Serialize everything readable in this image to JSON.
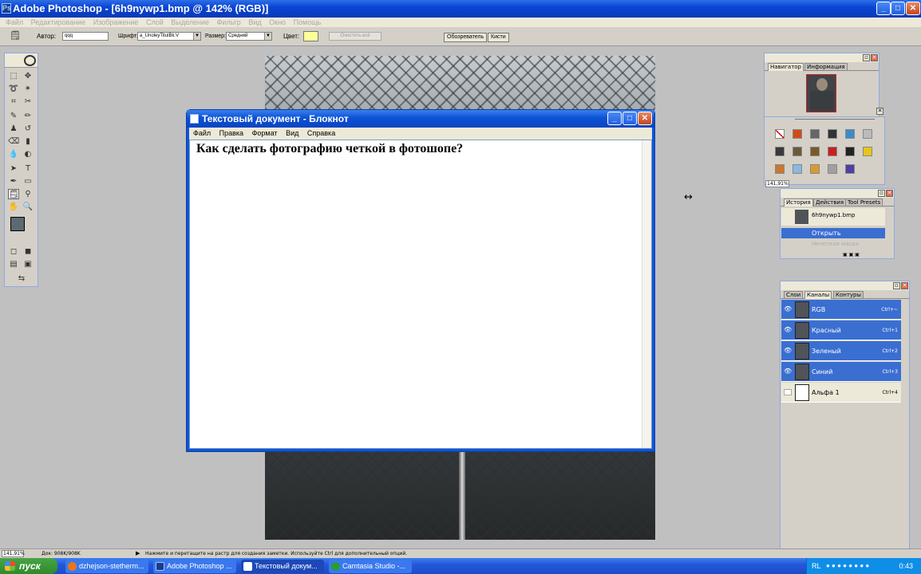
{
  "photoshop": {
    "title": "Adobe Photoshop - [6h9nywp1.bmp @ 142% (RGB)]",
    "menu": [
      "Файл",
      "Редактирование",
      "Изображение",
      "Слой",
      "Выделение",
      "Фильтр",
      "Вид",
      "Окно",
      "Помощь"
    ],
    "options": {
      "author_label": "Автор:",
      "author_value": "qqq",
      "font_label": "Шрифт:",
      "font_value": "a_UnoleyTitulBk:V",
      "size_label": "Размер:",
      "size_value": "Средний",
      "color_label": "Цвет:",
      "clear_button": "Очистить всё",
      "palette_tabs": [
        "Обозреватель",
        "Кисти"
      ]
    },
    "status": {
      "zoom": "141,91%",
      "doc": "Док: 908K/908K",
      "hint": "Нажмите и перетащите на растр для создания заметки. Используйте Ctrl для дополнительный опций."
    }
  },
  "navigator": {
    "tabs": [
      "Навигатор",
      "Информация"
    ],
    "zoom": "141,91%"
  },
  "history": {
    "tabs": [
      "История",
      "Действия",
      "Tool Presets"
    ],
    "snapshot": "6h9nywp1.bmp",
    "items": [
      "Открыть",
      "Нечеткая маска"
    ]
  },
  "channels": {
    "tabs": [
      "Слои",
      "Каналы",
      "Контуры"
    ],
    "rows": [
      {
        "name": "RGB",
        "shortcut": "Ctrl+~"
      },
      {
        "name": "Красный",
        "shortcut": "Ctrl+1"
      },
      {
        "name": "Зеленый",
        "shortcut": "Ctrl+2"
      },
      {
        "name": "Синий",
        "shortcut": "Ctrl+3"
      },
      {
        "name": "Альфа 1",
        "shortcut": "Ctrl+4"
      }
    ]
  },
  "notepad": {
    "title": "Текстовый документ - Блокнот",
    "menu": [
      "Файл",
      "Правка",
      "Формат",
      "Вид",
      "Справка"
    ],
    "text": "Как сделать фотографию четкой в фотошопе?"
  },
  "taskbar": {
    "start": "пуск",
    "tasks": [
      "dzhejson-stetherm...",
      "Adobe Photoshop ...",
      "Текстовый докум...",
      "Camtasia Studio -..."
    ],
    "lang": "RL",
    "time": "0:43"
  },
  "colors": {
    "title_blue": "#0a46d4",
    "selection_blue": "#3a6fd1",
    "start_green": "#308a2c"
  }
}
